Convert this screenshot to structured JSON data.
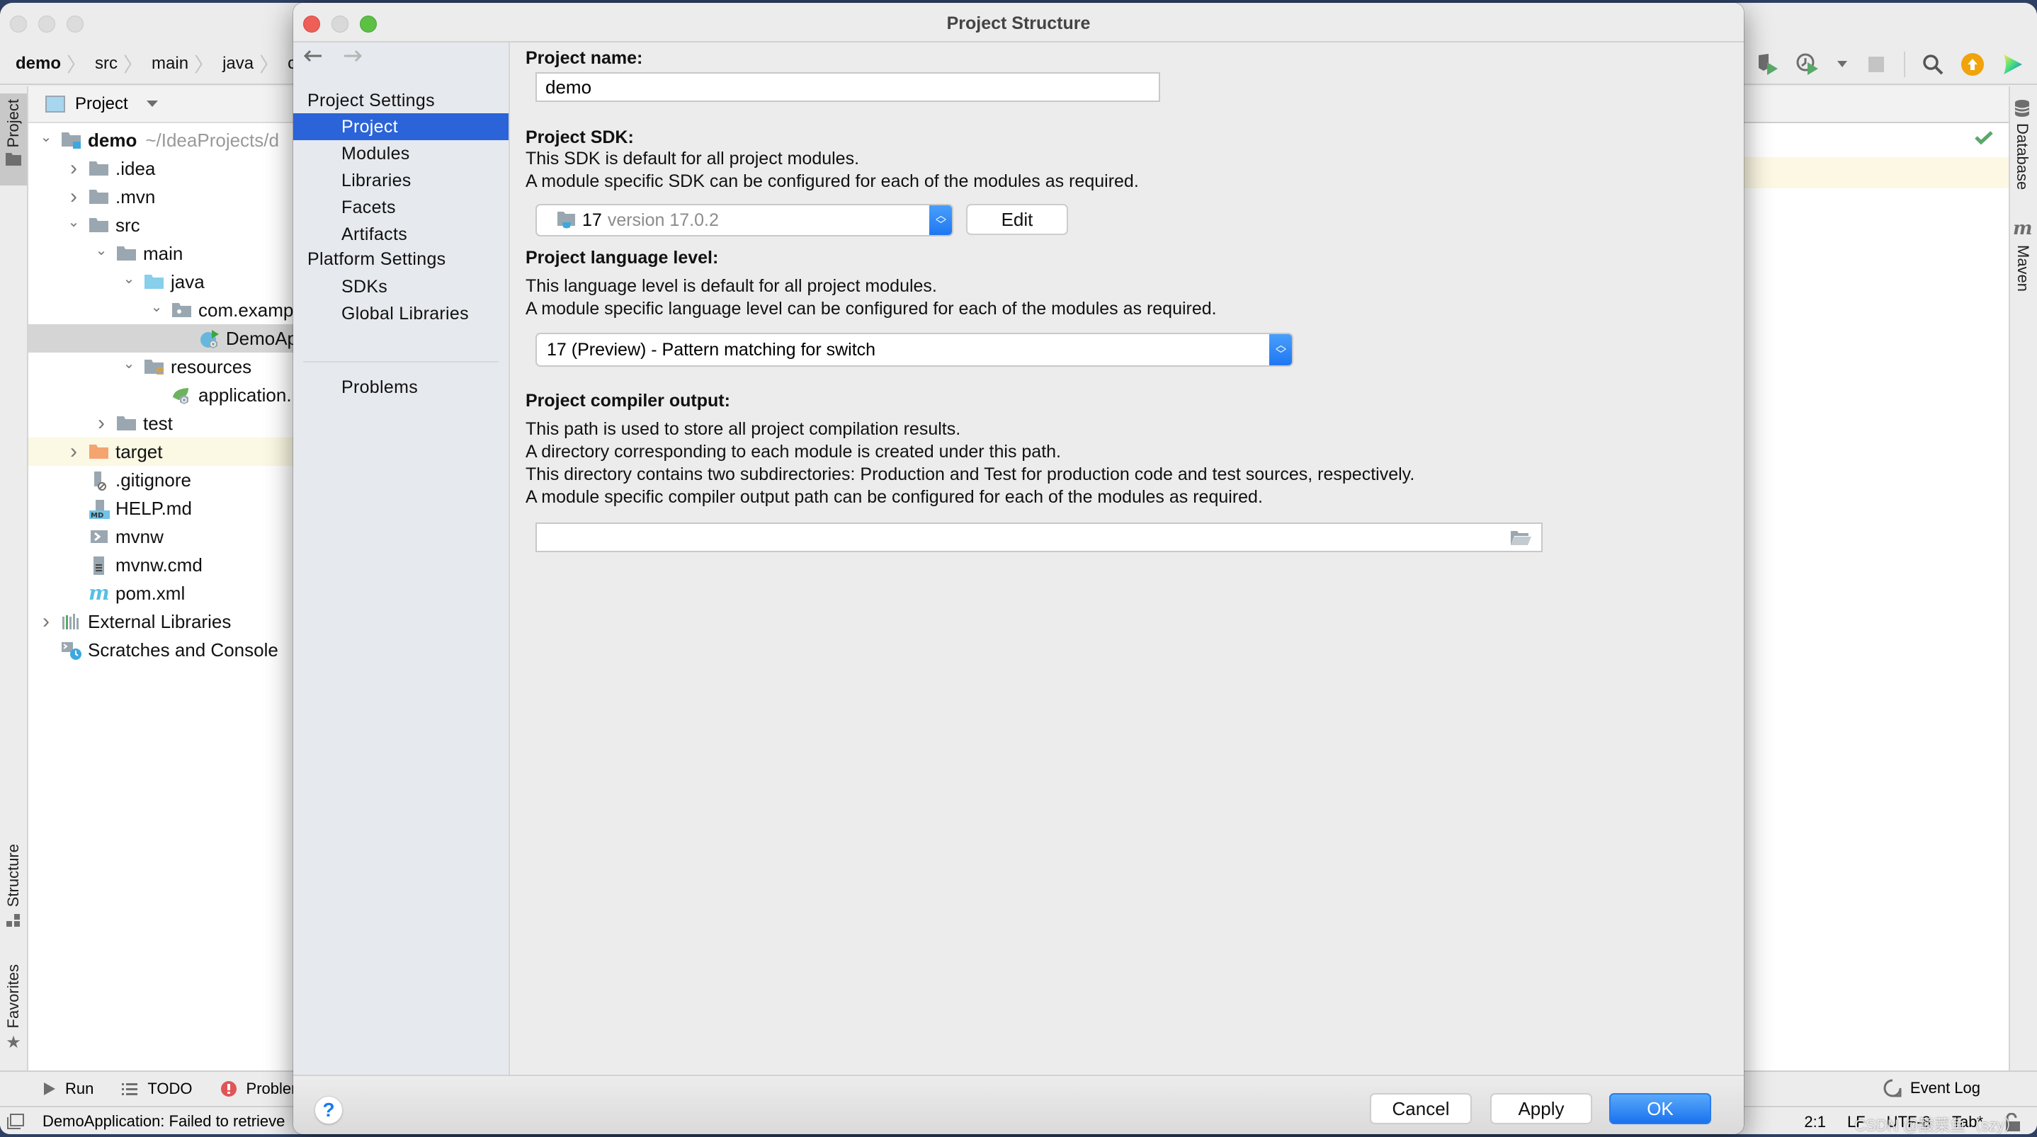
{
  "ide": {
    "breadcrumb": [
      "demo",
      "src",
      "main",
      "java",
      "com"
    ],
    "toolbar_icons": [
      "debug-icon",
      "run-with-coverage-icon",
      "profile-icon",
      "run-config-dropdown-icon",
      "stop-icon",
      "search-icon",
      "update-icon",
      "toolbox-icon"
    ],
    "left_stripe": {
      "project": "Project",
      "structure": "Structure",
      "favorites": "Favorites"
    },
    "right_stripe": {
      "database": "Database",
      "maven": "Maven"
    },
    "project_panel": {
      "header": "Project",
      "tree": [
        {
          "label": "demo",
          "extra": "~/IdeaProjects/d",
          "level": 0,
          "expanded": true,
          "icon": "module-folder-icon",
          "bold": true
        },
        {
          "label": ".idea",
          "level": 1,
          "expanded": false,
          "icon": "folder-icon"
        },
        {
          "label": ".mvn",
          "level": 1,
          "expanded": false,
          "icon": "folder-icon"
        },
        {
          "label": "src",
          "level": 1,
          "expanded": true,
          "icon": "folder-icon"
        },
        {
          "label": "main",
          "level": 2,
          "expanded": true,
          "icon": "folder-icon"
        },
        {
          "label": "java",
          "level": 3,
          "expanded": true,
          "icon": "source-folder-icon"
        },
        {
          "label": "com.examp",
          "level": 4,
          "expanded": true,
          "icon": "package-icon"
        },
        {
          "label": "DemoAp",
          "level": 5,
          "icon": "spring-boot-class-icon",
          "selected": true
        },
        {
          "label": "resources",
          "level": 3,
          "expanded": true,
          "icon": "resources-folder-icon"
        },
        {
          "label": "application.",
          "level": 4,
          "icon": "spring-config-icon"
        },
        {
          "label": "test",
          "level": 2,
          "expanded": false,
          "icon": "folder-icon"
        },
        {
          "label": "target",
          "level": 1,
          "expanded": false,
          "icon": "excluded-folder-icon",
          "excluded": true
        },
        {
          "label": ".gitignore",
          "level": 1,
          "icon": "gitignore-file-icon"
        },
        {
          "label": "HELP.md",
          "level": 1,
          "icon": "markdown-file-icon"
        },
        {
          "label": "mvnw",
          "level": 1,
          "icon": "shell-script-icon"
        },
        {
          "label": "mvnw.cmd",
          "level": 1,
          "icon": "text-file-icon"
        },
        {
          "label": "pom.xml",
          "level": 1,
          "icon": "maven-file-icon"
        },
        {
          "label": "External Libraries",
          "level": 0,
          "expanded": false,
          "icon": "libraries-icon"
        },
        {
          "label": "Scratches and Console",
          "level": 0,
          "icon": "scratches-icon"
        }
      ]
    },
    "bottom_tools": [
      {
        "label": "Run",
        "icon": "run-icon"
      },
      {
        "label": "TODO",
        "icon": "todo-list-icon"
      },
      {
        "label": "Problen",
        "icon": "problems-error-icon"
      }
    ],
    "event_log": "Event Log",
    "status": {
      "message": "DemoApplication: Failed to retrieve",
      "position": "2:1",
      "line_separator": "LF",
      "encoding": "UTF-8",
      "indent": "Tab*"
    },
    "watermark": "CSDN @酸菜鱼（szy）"
  },
  "dialog": {
    "title": "Project Structure",
    "nav": {
      "groups": [
        {
          "label": "Project Settings",
          "items": [
            "Project",
            "Modules",
            "Libraries",
            "Facets",
            "Artifacts"
          ]
        },
        {
          "label": "Platform Settings",
          "items": [
            "SDKs",
            "Global Libraries"
          ]
        }
      ],
      "extra": [
        "Problems"
      ],
      "active": "Project"
    },
    "project_name": {
      "label": "Project name:",
      "value": "demo"
    },
    "project_sdk": {
      "label": "Project SDK:",
      "desc1": "This SDK is default for all project modules.",
      "desc2": "A module specific SDK can be configured for each of the modules as required.",
      "selected_name": "17",
      "selected_version": "version 17.0.2",
      "edit_button": "Edit"
    },
    "language_level": {
      "label": "Project language level:",
      "desc1": "This language level is default for all project modules.",
      "desc2": "A module specific language level can be configured for each of the modules as required.",
      "selected": "17 (Preview) - Pattern matching for switch"
    },
    "compiler_output": {
      "label": "Project compiler output:",
      "desc1": "This path is used to store all project compilation results.",
      "desc2": "A directory corresponding to each module is created under this path.",
      "desc3": "This directory contains two subdirectories: Production and Test for production code and test sources, respectively.",
      "desc4": "A module specific compiler output path can be configured for each of the modules as required.",
      "value": "",
      "placeholder": ""
    },
    "buttons": {
      "help": "?",
      "cancel": "Cancel",
      "apply": "Apply",
      "ok": "OK"
    }
  },
  "colors": {
    "accent": "#2b63d8",
    "primary_button": "#1a73ee",
    "nav_bg": "#e6e9ed",
    "dialog_bg": "#ececec",
    "excluded_row": "#fbf8e3",
    "close": "#ee5f58",
    "zoom": "#5cc044"
  }
}
